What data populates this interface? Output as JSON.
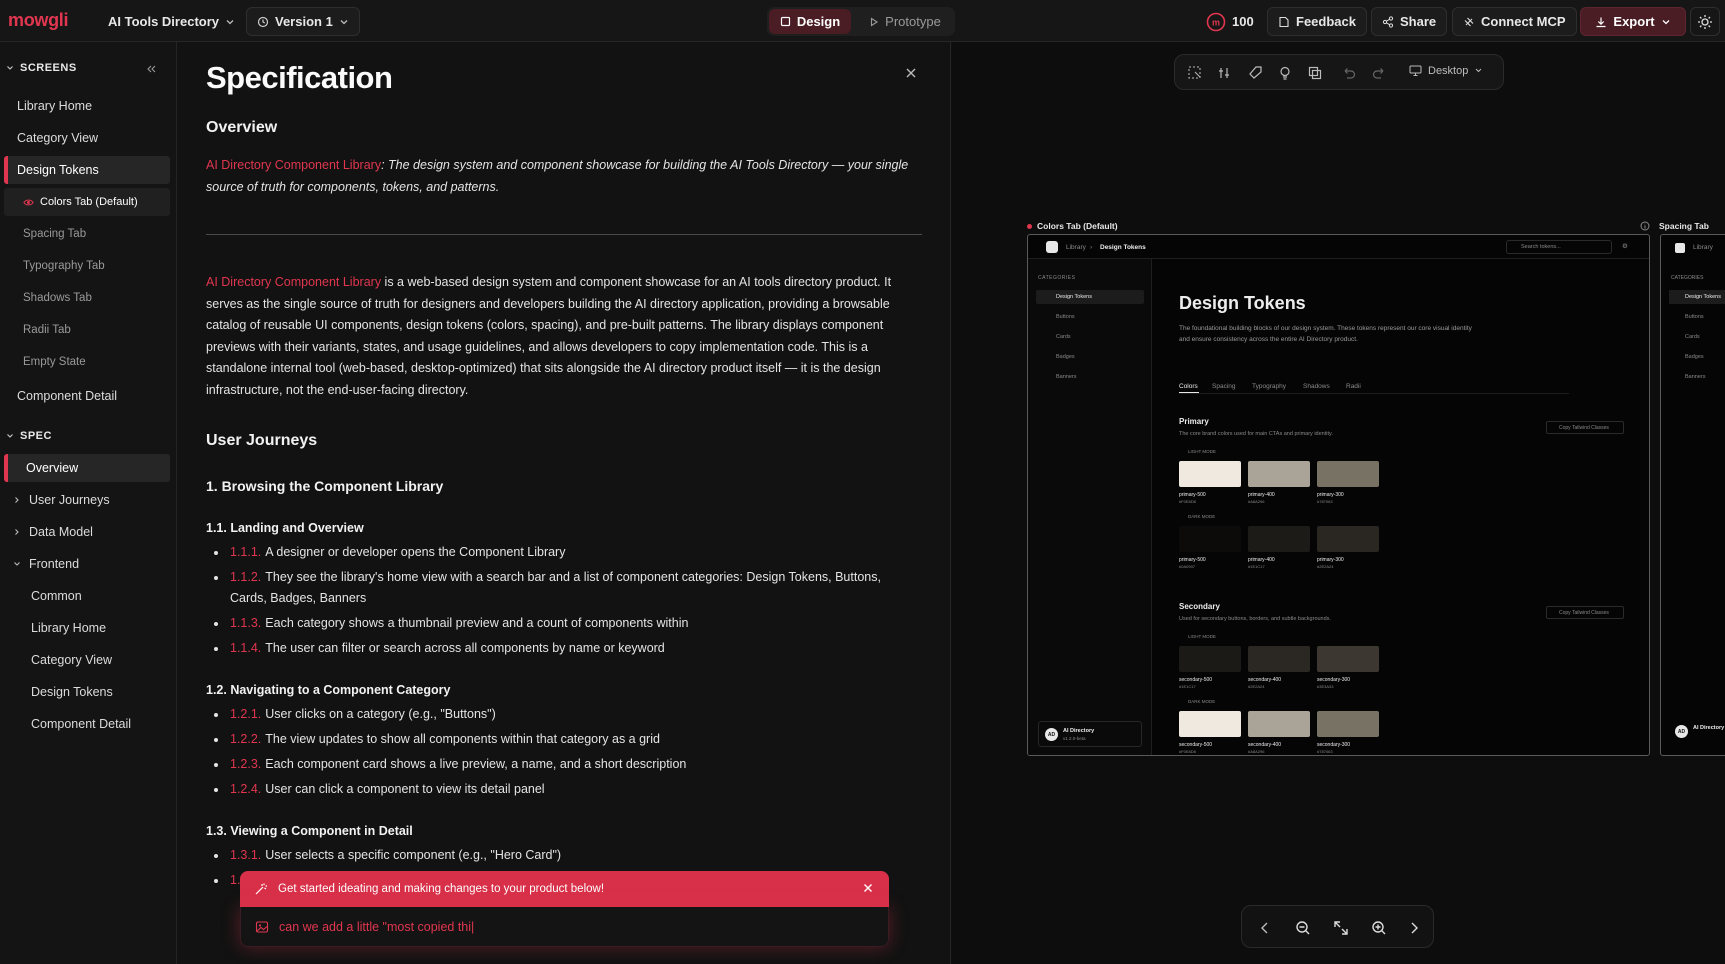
{
  "topbar": {
    "logo": "mowgli",
    "project": "AI Tools Directory",
    "version": "Version 1",
    "modes": {
      "design": "Design",
      "prototype": "Prototype"
    },
    "credits": "100",
    "feedback": "Feedback",
    "share": "Share",
    "connect": "Connect MCP",
    "export": "Export"
  },
  "sidebar": {
    "screens_heading": "SCREENS",
    "screens": [
      {
        "label": "Library Home"
      },
      {
        "label": "Category View"
      },
      {
        "label": "Design Tokens"
      },
      {
        "label": "Colors Tab (Default)"
      },
      {
        "label": "Spacing Tab"
      },
      {
        "label": "Typography Tab"
      },
      {
        "label": "Shadows Tab"
      },
      {
        "label": "Radii Tab"
      },
      {
        "label": "Empty State"
      },
      {
        "label": "Component Detail"
      }
    ],
    "spec_heading": "SPEC",
    "spec": [
      {
        "label": "Overview"
      },
      {
        "label": "User Journeys"
      },
      {
        "label": "Data Model"
      },
      {
        "label": "Frontend"
      },
      {
        "label": "Common"
      },
      {
        "label": "Library Home"
      },
      {
        "label": "Category View"
      },
      {
        "label": "Design Tokens"
      },
      {
        "label": "Component Detail"
      }
    ]
  },
  "spec": {
    "title": "Specification",
    "overview_heading": "Overview",
    "tagline_name": "AI Directory Component Library",
    "tagline_text": ": The design system and component showcase for building the AI Tools Directory — your single source of truth for components, tokens, and patterns.",
    "body_name": "AI Directory Component Library",
    "body_text": " is a web-based design system and component showcase for an AI tools directory product. It serves as the single source of truth for designers and developers building the AI directory application, providing a browsable catalog of reusable UI components, design tokens (colors, spacing), and pre-built patterns. The library displays component previews with their variants, states, and usage guidelines, and allows developers to copy implementation code. This is a standalone internal tool (web-based, desktop-optimized) that sits alongside the AI directory product itself — it is the design infrastructure, not the end-user-facing directory.",
    "journeys_heading": "User Journeys",
    "j1_heading": "1. Browsing the Component Library",
    "s11_heading": "1.1. Landing and Overview",
    "s11": [
      {
        "num": "1.1.1.",
        "text": "A designer or developer opens the Component Library"
      },
      {
        "num": "1.1.2.",
        "text": "They see the library's home view with a search bar and a list of component categories: Design Tokens, Buttons, Cards, Badges, Banners"
      },
      {
        "num": "1.1.3.",
        "text": "Each category shows a thumbnail preview and a count of components within"
      },
      {
        "num": "1.1.4.",
        "text": "The user can filter or search across all components by name or keyword"
      }
    ],
    "s12_heading": "1.2. Navigating to a Component Category",
    "s12": [
      {
        "num": "1.2.1.",
        "text": "User clicks on a category (e.g., \"Buttons\")"
      },
      {
        "num": "1.2.2.",
        "text": "The view updates to show all components within that category as a grid"
      },
      {
        "num": "1.2.3.",
        "text": "Each component card shows a live preview, a name, and a short description"
      },
      {
        "num": "1.2.4.",
        "text": "User can click a component to view its detail panel"
      }
    ],
    "s13_heading": "1.3. Viewing a Component in Detail",
    "s13": [
      {
        "num": "1.3.1.",
        "text": "User selects a specific component (e.g., \"Hero Card\")"
      },
      {
        "num": "1.",
        "text": ""
      }
    ]
  },
  "banner": {
    "text": "Get started ideating and making changes to your product below!"
  },
  "chat": {
    "value": "can we add a little \"most copied thi|"
  },
  "canvas": {
    "device": "Desktop",
    "frame1_label": "Colors Tab (Default)",
    "frame2_label": "Spacing Tab",
    "mini": {
      "crumb_root": "Library",
      "crumb_current": "Design Tokens",
      "search_placeholder": "Search tokens...",
      "categories_label": "CATEGORIES",
      "nav": [
        "Design Tokens",
        "Buttons",
        "Cards",
        "Badges",
        "Banners"
      ],
      "user_name": "AI Directory",
      "user_version": "v1.2.0-beta",
      "avatar": "AD",
      "title": "Design Tokens",
      "desc": "The foundational building blocks of our design system. These tokens represent our core visual identity and ensure consistency across the entire AI Directory product.",
      "tabs": [
        "Colors",
        "Spacing",
        "Typography",
        "Shadows",
        "Radii"
      ],
      "primary_title": "Primary",
      "primary_desc": "The core brand colors used for main CTAs and primary identity.",
      "secondary_title": "Secondary",
      "secondary_desc": "Used for secondary buttons, borders, and subtle backgrounds.",
      "copy_btn": "Copy Tailwind Classes",
      "light_mode": "LIGHT MODE",
      "dark_mode": "DARK MODE",
      "primary_light": [
        {
          "name": "primary-500",
          "hex": "#F0E8D8",
          "color": "#efe9df"
        },
        {
          "name": "primary-400",
          "hex": "#A8A296",
          "color": "#a9a398"
        },
        {
          "name": "primary-300",
          "hex": "#787063",
          "color": "#787265"
        }
      ],
      "primary_dark": [
        {
          "name": "primary-500",
          "hex": "#0A0907",
          "color": "#0c0b09"
        },
        {
          "name": "primary-400",
          "hex": "#1E1C17",
          "color": "#1d1b17"
        },
        {
          "name": "primary-300",
          "hex": "#2E2A24",
          "color": "#2a2722"
        }
      ],
      "secondary_light": [
        {
          "name": "secondary-500",
          "hex": "#1E1C17",
          "color": "#1c1a16"
        },
        {
          "name": "secondary-400",
          "hex": "#2E2A24",
          "color": "#2b2823"
        },
        {
          "name": "secondary-300",
          "hex": "#3E3A33",
          "color": "#3c3831"
        }
      ],
      "secondary_dark": [
        {
          "name": "secondary-500",
          "hex": "#F0E8D8",
          "color": "#efe9df"
        },
        {
          "name": "secondary-400",
          "hex": "#A8A296",
          "color": "#a9a398"
        },
        {
          "name": "secondary-300",
          "hex": "#787063",
          "color": "#787265"
        }
      ]
    }
  },
  "colors": {
    "accent": "#e0364f",
    "accent_dark": "#4a1c24",
    "bg": "#0f0f0f"
  }
}
